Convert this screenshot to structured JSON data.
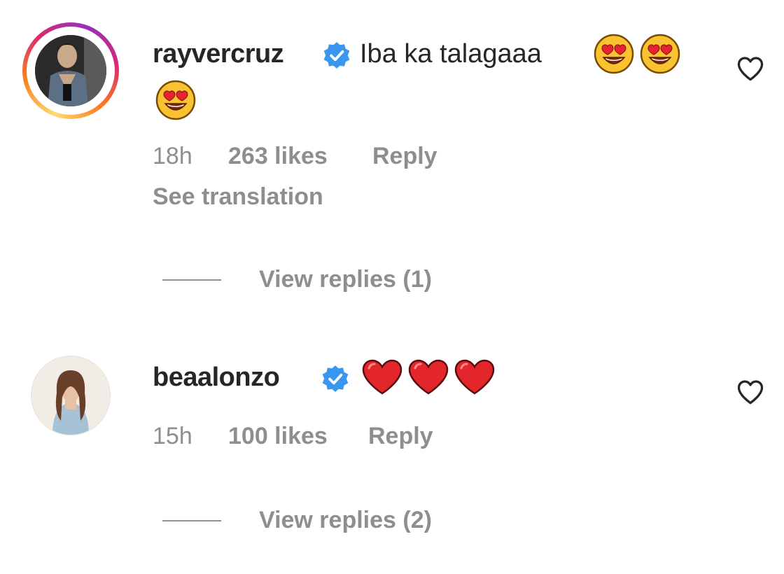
{
  "comments": [
    {
      "username": "rayvercruz",
      "text": "Iba ka talagaaa",
      "emojis": [
        "heart-eyes-emoji",
        "heart-eyes-emoji",
        "heart-eyes-emoji"
      ],
      "time": "18h",
      "likes": "263 likes",
      "reply_label": "Reply",
      "translation_label": "See translation",
      "view_replies": "View replies (1)",
      "has_story": true,
      "verified": true
    },
    {
      "username": "beaalonzo",
      "text": "",
      "emojis": [
        "red-heart-emoji",
        "red-heart-emoji",
        "red-heart-emoji"
      ],
      "time": "15h",
      "likes": "100 likes",
      "reply_label": "Reply",
      "view_replies": "View replies (2)",
      "has_story": false,
      "verified": true
    }
  ],
  "colors": {
    "text": "#262626",
    "muted": "#8e8e8e",
    "verified": "#3897f0",
    "heart": "#ed4956"
  },
  "icons": {
    "like": "heart-outline-icon",
    "verified": "verified-badge-icon"
  }
}
